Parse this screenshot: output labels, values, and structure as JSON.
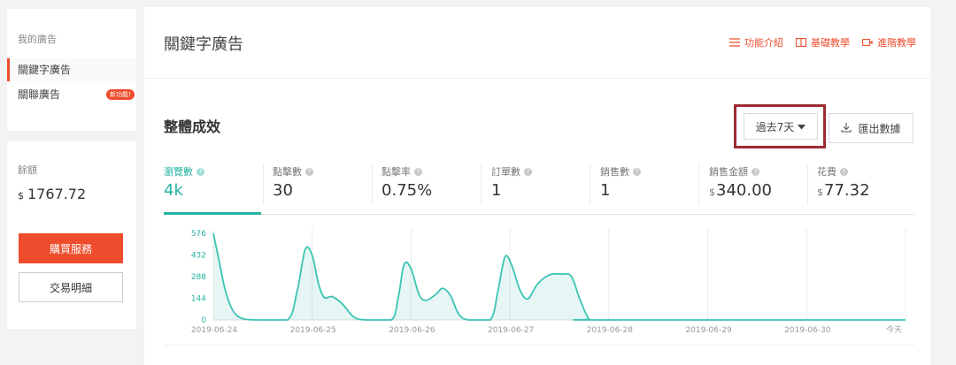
{
  "sidebar": {
    "section_label": "我的廣告",
    "items": [
      {
        "label": "關鍵字廣告",
        "active": true
      },
      {
        "label": "關聯廣告",
        "badge": "新功能!"
      }
    ],
    "balance_label": "餘額",
    "balance_currency": "$",
    "balance_value": "1767.72",
    "buy_button": "購買服務",
    "transactions_button": "交易明細"
  },
  "header": {
    "title": "關鍵字廣告",
    "links": [
      {
        "label": "功能介紹",
        "icon": "list-icon"
      },
      {
        "label": "基礎教學",
        "icon": "book-icon"
      },
      {
        "label": "進階教學",
        "icon": "video-icon"
      }
    ]
  },
  "performance": {
    "title": "整體成效",
    "date_range": "過去7天",
    "export_label": "匯出數據"
  },
  "metrics": [
    {
      "label": "瀏覽數",
      "value": "4k",
      "currency": "",
      "active": true
    },
    {
      "label": "點擊數",
      "value": "30",
      "currency": ""
    },
    {
      "label": "點擊率",
      "value": "0.75%",
      "currency": ""
    },
    {
      "label": "訂單數",
      "value": "1",
      "currency": ""
    },
    {
      "label": "銷售數",
      "value": "1",
      "currency": ""
    },
    {
      "label": "銷售金額",
      "value": "340.00",
      "currency": "$"
    },
    {
      "label": "花費",
      "value": "77.32",
      "currency": "$"
    }
  ],
  "colors": {
    "accent": "#ee4d2d",
    "teal": "#26b3a3",
    "highlight_box": "#9c2a33"
  },
  "chart_data": {
    "type": "area",
    "x_ticks": [
      "2019-06-24",
      "2019-06-25",
      "2019-06-26",
      "2019-06-27",
      "2019-06-28",
      "2019-06-29",
      "2019-06-30",
      "今天"
    ],
    "y_ticks": [
      0,
      144,
      288,
      432,
      576
    ],
    "ylim": [
      0,
      576
    ],
    "grid": true,
    "series": [
      {
        "points": [
          [
            0.0,
            576
          ],
          [
            0.05,
            420
          ],
          [
            0.12,
            200
          ],
          [
            0.2,
            60
          ],
          [
            0.3,
            8
          ],
          [
            0.45,
            0
          ],
          [
            0.75,
            0
          ],
          [
            0.85,
            200
          ],
          [
            0.93,
            470
          ],
          [
            1.0,
            430
          ],
          [
            1.06,
            250
          ],
          [
            1.12,
            150
          ],
          [
            1.2,
            155
          ],
          [
            1.3,
            110
          ],
          [
            1.42,
            20
          ],
          [
            1.55,
            0
          ],
          [
            1.8,
            0
          ],
          [
            1.87,
            150
          ],
          [
            1.93,
            370
          ],
          [
            2.0,
            340
          ],
          [
            2.08,
            170
          ],
          [
            2.15,
            130
          ],
          [
            2.25,
            170
          ],
          [
            2.32,
            210
          ],
          [
            2.4,
            160
          ],
          [
            2.48,
            40
          ],
          [
            2.58,
            0
          ],
          [
            2.8,
            0
          ],
          [
            2.88,
            200
          ],
          [
            2.95,
            420
          ],
          [
            3.02,
            360
          ],
          [
            3.1,
            200
          ],
          [
            3.18,
            140
          ],
          [
            3.28,
            240
          ],
          [
            3.4,
            300
          ],
          [
            3.52,
            305
          ],
          [
            3.62,
            290
          ],
          [
            3.7,
            150
          ],
          [
            3.8,
            5
          ],
          [
            3.9,
            0
          ],
          [
            7.0,
            0
          ]
        ]
      }
    ]
  }
}
